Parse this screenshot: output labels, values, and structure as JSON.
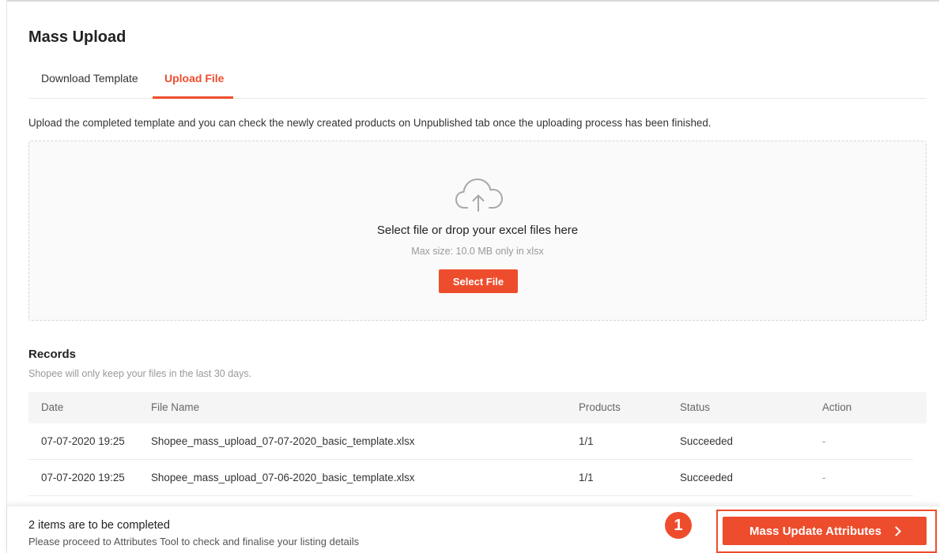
{
  "page": {
    "title": "Mass Upload"
  },
  "tabs": [
    {
      "label": "Download Template",
      "active": false
    },
    {
      "label": "Upload File",
      "active": true
    }
  ],
  "upload": {
    "description": "Upload the completed template and you can check the newly created products on Unpublished tab once the uploading process has been finished.",
    "drop_title": "Select file or drop your excel files here",
    "drop_subtitle": "Max size: 10.0 MB only in xlsx",
    "select_button": "Select File",
    "icon": "cloud-upload-icon"
  },
  "records": {
    "title": "Records",
    "note": "Shopee will only keep your files in the last 30 days.",
    "columns": [
      "Date",
      "File Name",
      "Products",
      "Status",
      "Action"
    ],
    "rows": [
      {
        "date": "07-07-2020 19:25",
        "file_name": "Shopee_mass_upload_07-07-2020_basic_template.xlsx",
        "products": "1/1",
        "status": "Succeeded",
        "action": "-"
      },
      {
        "date": "07-07-2020 19:25",
        "file_name": "Shopee_mass_upload_07-06-2020_basic_template.xlsx",
        "products": "1/1",
        "status": "Succeeded",
        "action": "-"
      }
    ]
  },
  "footer": {
    "title": "2 items are to be completed",
    "subtitle": "Please proceed to Attributes Tool to check and finalise your listing details",
    "step_number": "1",
    "button_label": "Mass Update Attributes"
  },
  "colors": {
    "accent": "#ee4d2d",
    "text": "#333333",
    "muted": "#999999",
    "table_header_bg": "#f5f5f5"
  }
}
